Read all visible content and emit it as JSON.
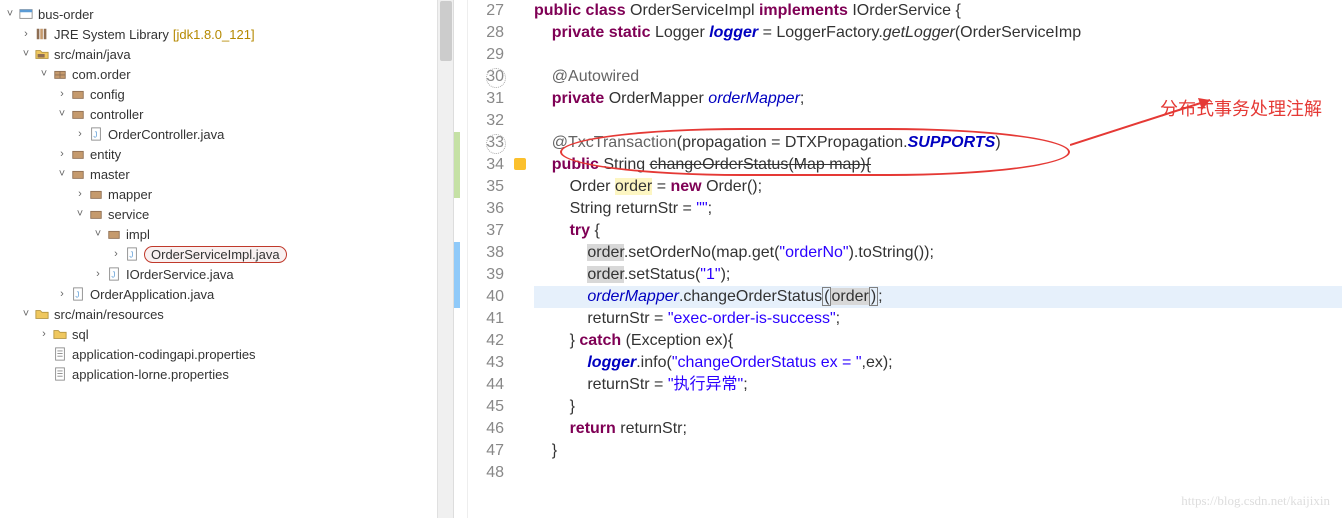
{
  "tree": {
    "project": "bus-order",
    "jre": "JRE System Library",
    "jre_deco": "[jdk1.8.0_121]",
    "srcmainjava": "src/main/java",
    "pkg_comorder": "com.order",
    "pkg_config": "config",
    "pkg_controller": "controller",
    "file_ordercontroller": "OrderController.java",
    "pkg_entity": "entity",
    "pkg_master": "master",
    "pkg_mapper": "mapper",
    "pkg_service": "service",
    "pkg_impl": "impl",
    "file_orderserviceimpl": "OrderServiceImpl.java",
    "file_iorderservice": "IOrderService.java",
    "file_orderapplication": "OrderApplication.java",
    "srcmainresources": "src/main/resources",
    "folder_sql": "sql",
    "file_appcoding": "application-codingapi.properties",
    "file_applorne": "application-lorne.properties"
  },
  "linenos": [
    "27",
    "28",
    "29",
    "30",
    "31",
    "32",
    "33",
    "34",
    "35",
    "36",
    "37",
    "38",
    "39",
    "40",
    "41",
    "42",
    "43",
    "44",
    "45",
    "46",
    "47",
    "48"
  ],
  "code": {
    "l27": {
      "kw1": "public class",
      "cls": "OrderServiceImpl",
      "kw2": "implements",
      "iface": "IOrderService",
      "brace": " {"
    },
    "l28": {
      "kw": "private static",
      "type": "Logger",
      "field": "logger",
      "eq": " = LoggerFactory.",
      "method": "getLogger",
      "rest": "(OrderServiceImp"
    },
    "l30": {
      "ann": "@Autowired"
    },
    "l31": {
      "kw": "private",
      "type": " OrderMapper ",
      "field": "orderMapper",
      "semi": ";"
    },
    "l33": {
      "ann": "@TxcTransaction",
      "open": "(propagation = DTXPropagation.",
      "supp": "SUPPORTS",
      "close": ")"
    },
    "l34": {
      "kw": "public",
      "ret": " String ",
      "name": "changeOrderStatus",
      "params": "(Map map){"
    },
    "l35": {
      "type": "Order ",
      "var": "order",
      "eq": " = ",
      "kw": "new",
      "rest": " Order();"
    },
    "l36": {
      "text": "String returnStr = ",
      "str": "\"\"",
      "semi": ";"
    },
    "l37": {
      "kw": "try",
      "brace": " {"
    },
    "l38": {
      "var": "order",
      "rest": ".setOrderNo(map.get(",
      "str": "\"orderNo\"",
      "rest2": ").toString());"
    },
    "l39": {
      "var": "order",
      "rest": ".setStatus(",
      "str": "\"1\"",
      "rest2": ");"
    },
    "l40": {
      "field": "orderMapper",
      "rest": ".changeOrderStatus",
      "p1": "(",
      "var": "order",
      "p2": ")",
      "semi": ";"
    },
    "l41": {
      "text": "returnStr = ",
      "str": "\"exec-order-is-success\"",
      "semi": ";"
    },
    "l42": {
      "close": "} ",
      "kw": "catch",
      "rest": " (Exception ex){"
    },
    "l43": {
      "field": "logger",
      "rest": ".info(",
      "str": "\"changeOrderStatus ex = \"",
      "rest2": ",ex);"
    },
    "l44": {
      "text": "returnStr = ",
      "str": "\"执行异常\"",
      "semi": ";"
    },
    "l45": {
      "brace": "}"
    },
    "l46": {
      "kw": "return",
      "rest": " returnStr;"
    },
    "l47": {
      "brace": "}"
    }
  },
  "annotation_text": "分布式事务处理注解",
  "watermark": "https://blog.csdn.net/kaijixin"
}
